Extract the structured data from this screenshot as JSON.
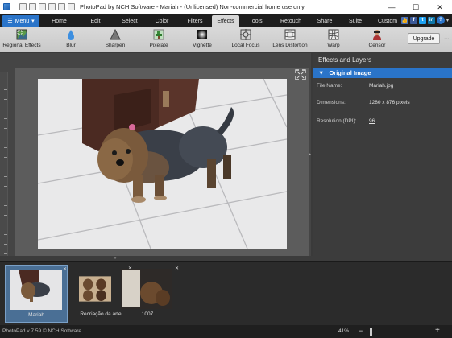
{
  "window": {
    "title": "PhotoPad by NCH Software - Mariah - (Unlicensed) Non-commercial home use only",
    "minimize": "—",
    "maximize": "☐",
    "close": "✕"
  },
  "menu": {
    "menu_button": "Menu",
    "tabs": [
      "Home",
      "Edit",
      "Select",
      "Color",
      "Filters",
      "Effects",
      "Tools",
      "Retouch",
      "Share",
      "Suite",
      "Custom"
    ],
    "active_tab": "Effects",
    "help": "?"
  },
  "toolbar": {
    "tools": [
      {
        "label": "Regional Effects",
        "icon": "regional-effects-icon"
      },
      {
        "label": "Blur",
        "icon": "water-drop-icon"
      },
      {
        "label": "Sharpen",
        "icon": "triangle-icon"
      },
      {
        "label": "Pixelate",
        "icon": "pixel-tree-icon"
      },
      {
        "label": "Vignette",
        "icon": "vignette-icon"
      },
      {
        "label": "Local Focus",
        "icon": "crosshair-icon"
      },
      {
        "label": "Lens Distortion",
        "icon": "lens-grid-icon"
      },
      {
        "label": "Warp",
        "icon": "warp-grid-icon"
      },
      {
        "label": "Censor",
        "icon": "censor-person-icon"
      }
    ],
    "upgrade_label": "Upgrade"
  },
  "panel": {
    "title": "Effects and Layers",
    "section": "Original Image",
    "rows": [
      {
        "label": "File Name:",
        "value": "Mariah.jpg"
      },
      {
        "label": "Dimensions:",
        "value": "1280 x 876 pixels"
      },
      {
        "label": "Resolution (DPI):",
        "value": "96"
      }
    ]
  },
  "thumbnails": [
    {
      "caption": "Mariah",
      "active": true
    },
    {
      "caption": "Recriação da arte",
      "active": false
    },
    {
      "caption": "1007",
      "active": false
    }
  ],
  "status": {
    "text": "PhotoPad v 7.59 © NCH Software",
    "zoom": "41%",
    "zoom_minus": "−",
    "zoom_plus": "+"
  },
  "colors": {
    "accent": "#2a74c9",
    "menubar": "#1e1e1e",
    "panel": "#3c3c3c"
  }
}
